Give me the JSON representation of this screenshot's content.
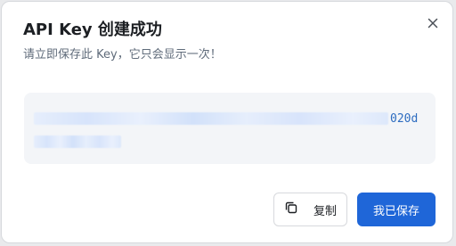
{
  "dialog": {
    "title": "API Key 创建成功",
    "subtitle": "请立即保存此 Key，它只会显示一次！",
    "close_icon": "close-icon"
  },
  "key": {
    "visible_suffix": "020d",
    "masked": true
  },
  "actions": {
    "copy_label": "复制",
    "copy_icon": "copy-icon",
    "save_label": "我已保存"
  },
  "colors": {
    "primary": "#1f66d8",
    "key_text": "#2d6cc0",
    "key_box_bg": "#f3f5f8"
  }
}
